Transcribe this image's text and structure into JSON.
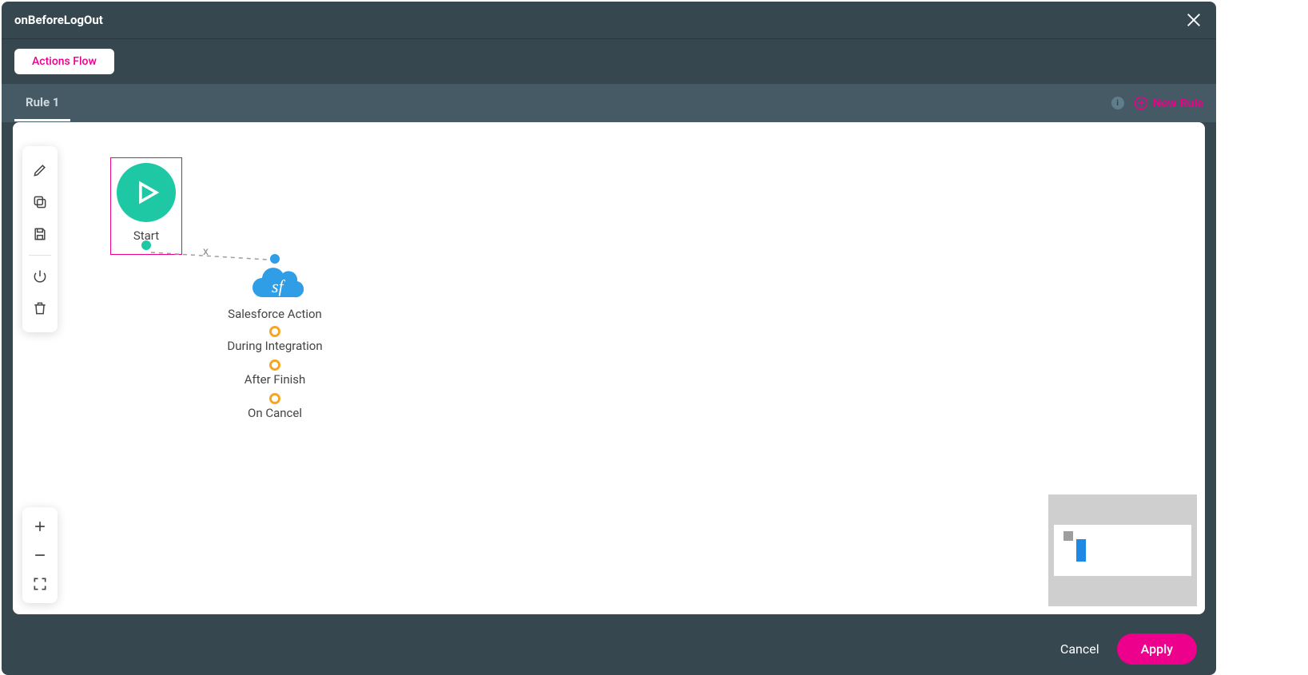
{
  "modal": {
    "title": "onBeforeLogOut"
  },
  "tabs": {
    "actions_flow": "Actions Flow",
    "rule": "Rule 1",
    "new_rule": "New Rule",
    "info_char": "i"
  },
  "toolbar_left": {
    "edit": "edit-icon",
    "copy": "copy-icon",
    "save": "save-icon",
    "power": "power-icon",
    "delete": "trash-icon"
  },
  "toolbar_zoom": {
    "zoom_in": "plus-icon",
    "zoom_out": "minus-icon",
    "fit": "fullscreen-icon"
  },
  "canvas": {
    "start": {
      "label": "Start"
    },
    "connector": {
      "delete_label": "x"
    },
    "sf": {
      "label": "Salesforce Action",
      "icon_text": "sf",
      "ports": [
        {
          "label": "During Integration"
        },
        {
          "label": "After Finish"
        },
        {
          "label": "On Cancel"
        }
      ]
    }
  },
  "footer": {
    "cancel": "Cancel",
    "apply": "Apply"
  }
}
